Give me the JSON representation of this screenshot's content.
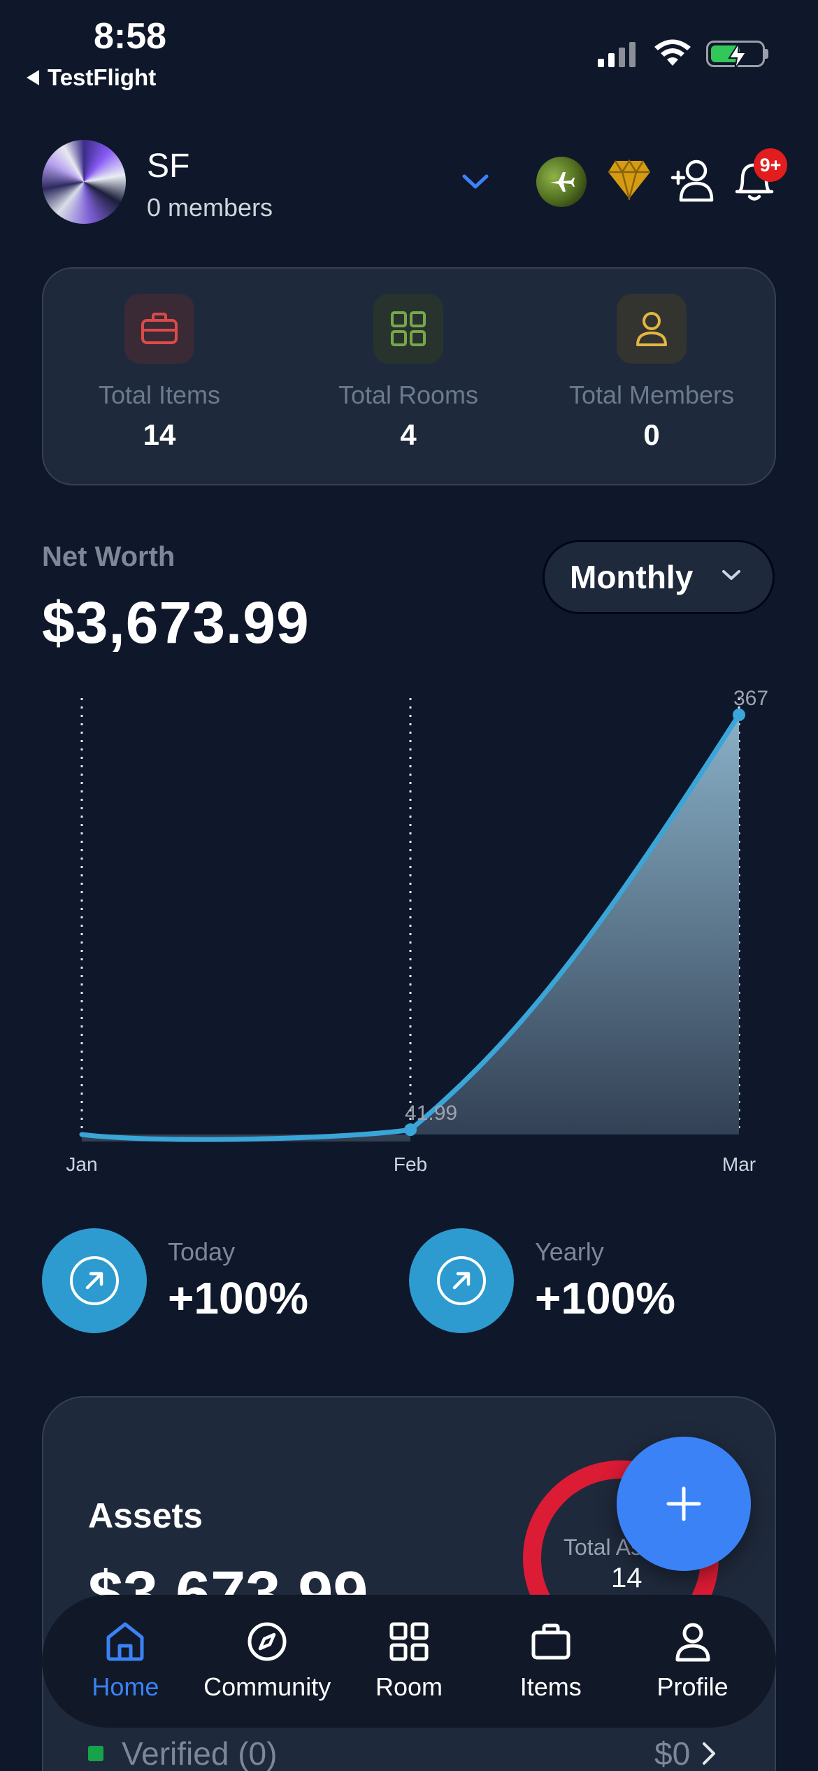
{
  "status_bar": {
    "time": "8:58",
    "back_label": "TestFlight"
  },
  "header": {
    "group_name": "SF",
    "members_text": "0 members",
    "notification_badge": "9+"
  },
  "stats": [
    {
      "label": "Total Items",
      "value": "14",
      "icon": "briefcase-icon",
      "color": "#dc4a4a"
    },
    {
      "label": "Total Rooms",
      "value": "4",
      "icon": "grid-icon",
      "color": "#7aa64a"
    },
    {
      "label": "Total Members",
      "value": "0",
      "icon": "user-icon",
      "color": "#e2b640"
    }
  ],
  "net_worth": {
    "label": "Net Worth",
    "value": "$3,673.99",
    "period": "Monthly"
  },
  "chart_data": {
    "type": "area",
    "categories": [
      "Jan",
      "Feb",
      "Mar"
    ],
    "values": [
      0,
      41.99,
      3673.99
    ],
    "point_labels": [
      "",
      "41.99",
      "367"
    ],
    "ylim": [
      0,
      3673.99
    ],
    "grid": "vertical-dotted",
    "color": "#3aa5d9"
  },
  "changes": [
    {
      "label": "Today",
      "value": "+100%"
    },
    {
      "label": "Yearly",
      "value": "+100%"
    }
  ],
  "assets": {
    "title": "Assets",
    "value": "$3,673.99",
    "ring_label": "Total Assets",
    "ring_value": "14",
    "verified_label": "Verified (0)",
    "verified_amount": "$0"
  },
  "tabs": [
    {
      "label": "Home",
      "icon": "home-icon",
      "active": true
    },
    {
      "label": "Community",
      "icon": "compass-icon",
      "active": false
    },
    {
      "label": "Room",
      "icon": "grid-icon",
      "active": false
    },
    {
      "label": "Items",
      "icon": "briefcase-icon",
      "active": false
    },
    {
      "label": "Profile",
      "icon": "user-icon",
      "active": false
    }
  ]
}
